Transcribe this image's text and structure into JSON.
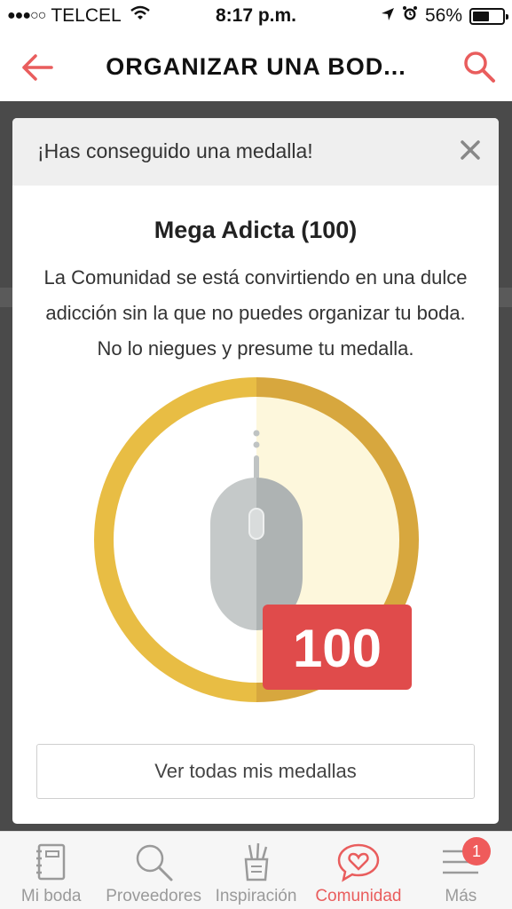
{
  "status_bar": {
    "carrier": "TELCEL",
    "time": "8:17 p.m.",
    "battery": "56%",
    "battery_level": 0.56
  },
  "header": {
    "title": "ORGANIZAR UNA BOD...",
    "accent_color": "#e95d5d"
  },
  "modal": {
    "header_title": "¡Has conseguido una medalla!",
    "medal_name": "Mega Adicta (100)",
    "description": "La Comunidad se está convirtiendo en una dulce adicción sin la que no puedes organizar tu boda. No lo niegues y presume tu medalla.",
    "medal_badge": "100",
    "medal_icon": "computer-mouse-icon",
    "button_label": "Ver todas mis medallas"
  },
  "tab_bar": {
    "tabs": [
      {
        "label": "Mi boda",
        "icon": "notebook-icon",
        "active": false
      },
      {
        "label": "Proveedores",
        "icon": "search-icon",
        "active": false
      },
      {
        "label": "Inspiración",
        "icon": "pencil-cup-icon",
        "active": false
      },
      {
        "label": "Comunidad",
        "icon": "heart-chat-icon",
        "active": true
      },
      {
        "label": "Más",
        "icon": "menu-icon",
        "active": false,
        "badge": "1"
      }
    ]
  }
}
